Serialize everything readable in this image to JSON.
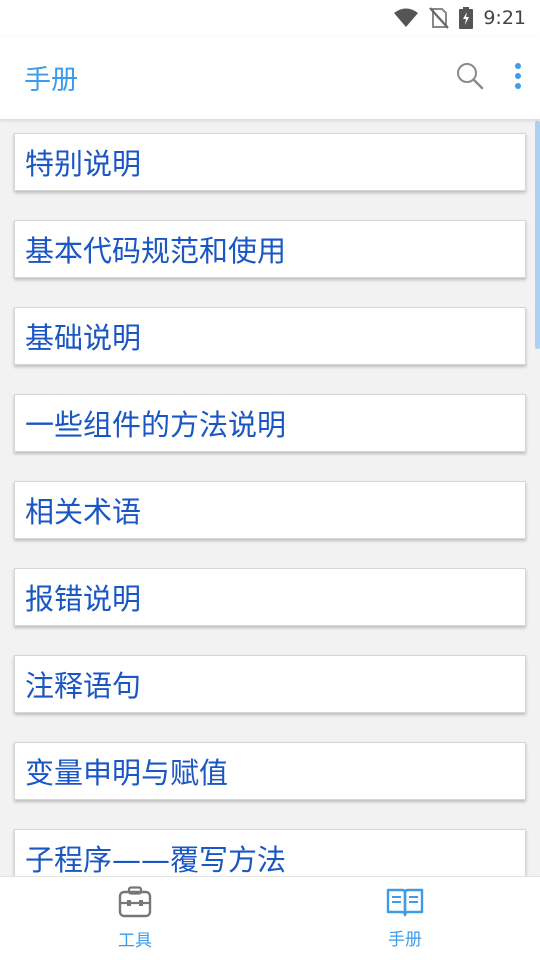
{
  "status_bar": {
    "time": "9:21"
  },
  "app_bar": {
    "title": "手册"
  },
  "colors": {
    "accent": "#3d9be9",
    "item_text": "#1a56c4"
  },
  "list": {
    "items": [
      {
        "label": "特别说明"
      },
      {
        "label": "基本代码规范和使用"
      },
      {
        "label": "基础说明"
      },
      {
        "label": "一些组件的方法说明"
      },
      {
        "label": "相关术语"
      },
      {
        "label": "报错说明"
      },
      {
        "label": "注释语句"
      },
      {
        "label": "变量申明与赋值"
      },
      {
        "label": "子程序——覆写方法"
      }
    ]
  },
  "bottom_nav": {
    "items": [
      {
        "label": "工具",
        "icon": "toolbox-icon"
      },
      {
        "label": "手册",
        "icon": "book-icon"
      }
    ]
  }
}
